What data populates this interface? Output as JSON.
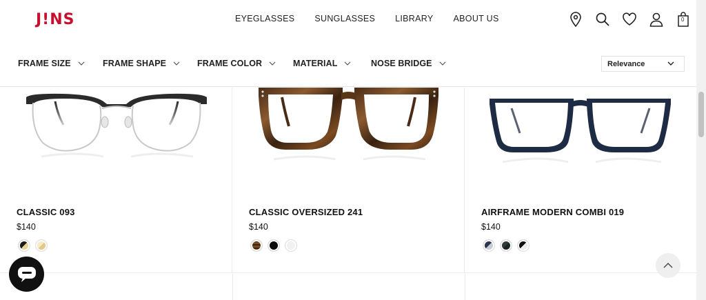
{
  "header": {
    "logo": "J!NS",
    "nav": [
      "EYEGLASSES",
      "SUNGLASSES",
      "LIBRARY",
      "ABOUT US"
    ],
    "cart_count": "0",
    "icons": [
      "location-pin-icon",
      "search-icon",
      "heart-icon",
      "user-icon",
      "bag-icon"
    ]
  },
  "filters": {
    "items": [
      "FRAME SIZE",
      "FRAME SHAPE",
      "FRAME COLOR",
      "MATERIAL",
      "NOSE BRIDGE"
    ],
    "sort_selected": "Relevance"
  },
  "products": [
    {
      "name": "CLASSIC 093",
      "price": "$140",
      "swatches": [
        {
          "color_a": "#1a1a1a",
          "color_b": "#e9d296"
        },
        {
          "color_a": "#f6e9c4",
          "color_b": "#e2c98a"
        }
      ]
    },
    {
      "name": "CLASSIC OVERSIZED 241",
      "price": "$140",
      "swatches": [
        {
          "color_a": "#7a4a22",
          "color_b": "#3b2410"
        },
        {
          "color_a": "#0a0a0a",
          "color_b": "#0a0a0a"
        },
        {
          "color_a": "#f1f1f4",
          "color_b": "#f1f1f4"
        }
      ]
    },
    {
      "name": "AIRFRAME MODERN COMBI 019",
      "price": "$140",
      "swatches": [
        {
          "color_a": "#2c3550",
          "color_b": "#c9ccd6"
        },
        {
          "color_a": "#2f3a3a",
          "color_b": "#1b2424"
        },
        {
          "color_a": "#111111",
          "color_b": "#eeeeee"
        }
      ]
    }
  ],
  "colors": {
    "brand_red": "#c8102e",
    "text": "#111111",
    "divider": "#ececec"
  }
}
